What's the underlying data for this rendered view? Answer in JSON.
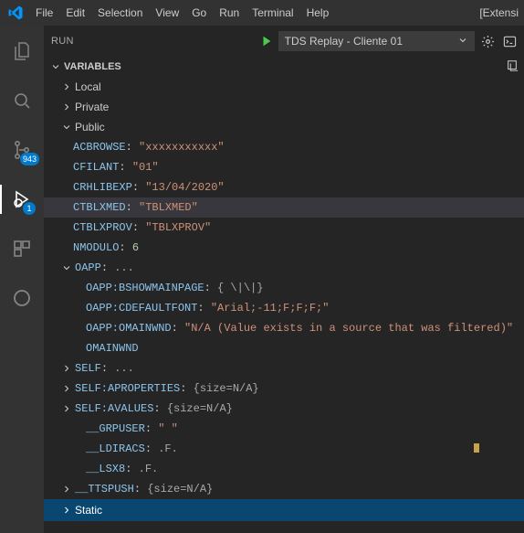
{
  "menubar": {
    "items": [
      "File",
      "Edit",
      "Selection",
      "View",
      "Go",
      "Run",
      "Terminal",
      "Help"
    ],
    "right_text": "[Extensi"
  },
  "activitybar": {
    "source_control_badge": "943",
    "debug_badge": "1"
  },
  "panel": {
    "title": "RUN",
    "config_label": "TDS Replay - Cliente 01"
  },
  "sections": {
    "variables": "VARIABLES",
    "local": "Local",
    "private": "Private",
    "public": "Public",
    "static": "Static"
  },
  "vars": {
    "acbrowse": {
      "name": "ACBROWSE",
      "value": "\"xxxxxxxxxxx\"",
      "type": "str"
    },
    "cfilant": {
      "name": "CFILANT",
      "value": "\"01\"",
      "type": "str"
    },
    "crhlibexp": {
      "name": "CRHLIBEXP",
      "value": "\"13/04/2020\"",
      "type": "str"
    },
    "ctblxmed": {
      "name": "CTBLXMED",
      "value": "\"TBLXMED\"",
      "type": "str"
    },
    "ctblxprov": {
      "name": "CTBLXPROV",
      "value": "\"TBLXPROV\"",
      "type": "str"
    },
    "nmodulo": {
      "name": "NMODULO",
      "value": "6",
      "type": "num"
    },
    "oapp": {
      "name": "OAPP",
      "value": "...",
      "type": "obj"
    },
    "oapp_bshow": {
      "name": "OAPP:BSHOWMAINPAGE",
      "value": "{ \\|\\|}",
      "type": "obj"
    },
    "oapp_cfont": {
      "name": "OAPP:CDEFAULTFONT",
      "value": "\"Arial;-11;F;F;F;\"",
      "type": "str"
    },
    "oapp_omain": {
      "name": "OAPP:OMAINWND",
      "value": "\"N/A (Value exists in a source that was filtered)\"",
      "type": "str"
    },
    "omainwnd": {
      "name": "OMAINWND",
      "value": "",
      "type": "none"
    },
    "self": {
      "name": "SELF",
      "value": "...",
      "type": "obj"
    },
    "self_aprop": {
      "name": "SELF:APROPERTIES",
      "value": "{size=N/A}",
      "type": "obj"
    },
    "self_avals": {
      "name": "SELF:AVALUES",
      "value": "{size=N/A}",
      "type": "obj"
    },
    "grpuser": {
      "name": "__GRPUSER",
      "value": "\"      \"",
      "type": "str"
    },
    "ldiracs": {
      "name": "__LDIRACS",
      "value": ".F.",
      "type": "obj"
    },
    "lsx8": {
      "name": "__LSX8",
      "value": ".F.",
      "type": "obj"
    },
    "ttspush": {
      "name": "__TTSPUSH",
      "value": "{size=N/A}",
      "type": "obj"
    }
  }
}
